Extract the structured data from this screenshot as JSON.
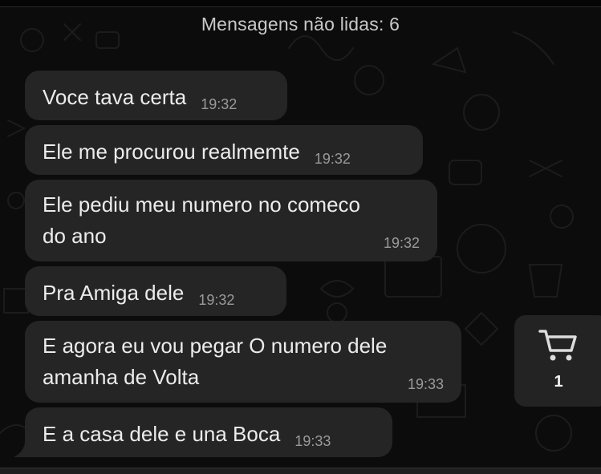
{
  "chat": {
    "unread_banner": "Mensagens não lidas: 6",
    "messages": [
      {
        "text": "Voce tava certa",
        "time": "19:32"
      },
      {
        "text": "Ele me procurou realmemte",
        "time": "19:32"
      },
      {
        "text": "Ele pediu meu numero no comeco do ano",
        "line1": "Ele pediu meu numero no comeco",
        "line2": "do ano",
        "time": "19:32"
      },
      {
        "text": "Pra Amiga dele",
        "time": "19:32"
      },
      {
        "text": "E agora eu vou pegar O numero dele amanha de Volta",
        "line1": "E agora eu vou pegar O numero dele",
        "line2": "amanha de Volta",
        "time": "19:33"
      },
      {
        "text": "E a casa dele e una Boca",
        "time": "19:33"
      }
    ]
  },
  "cart": {
    "icon": "cart-icon",
    "count": "1"
  },
  "theme": {
    "background": "#0c0c0c",
    "bubble": "#252525",
    "text": "#ececec",
    "time": "#9a9a9a"
  }
}
